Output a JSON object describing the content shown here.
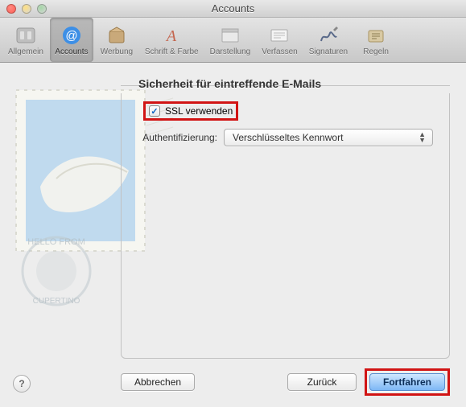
{
  "window": {
    "title": "Accounts"
  },
  "toolbar": {
    "items": [
      {
        "label": "Allgemein"
      },
      {
        "label": "Accounts"
      },
      {
        "label": "Werbung"
      },
      {
        "label": "Schrift & Farbe"
      },
      {
        "label": "Darstellung"
      },
      {
        "label": "Verfassen"
      },
      {
        "label": "Signaturen"
      },
      {
        "label": "Regeln"
      }
    ]
  },
  "panel": {
    "section_title": "Sicherheit für eintreffende E-Mails",
    "ssl_label": "SSL verwenden",
    "ssl_checked": true,
    "auth_label": "Authentifizierung:",
    "auth_value": "Verschlüsseltes Kennwort"
  },
  "buttons": {
    "cancel": "Abbrechen",
    "back": "Zurück",
    "continue": "Fortfahren"
  },
  "help": "?"
}
